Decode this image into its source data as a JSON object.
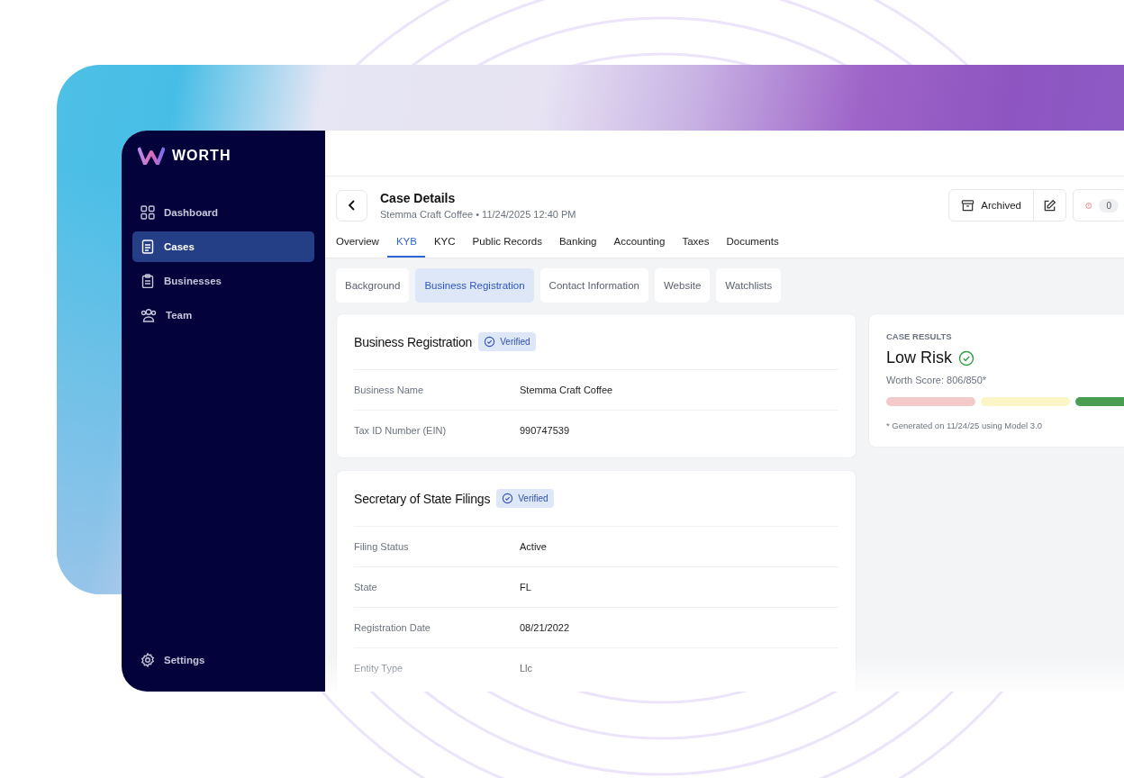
{
  "brand": {
    "name": "WORTH"
  },
  "sidebar": {
    "items": [
      {
        "label": "Dashboard",
        "selected": false
      },
      {
        "label": "Cases",
        "selected": true
      },
      {
        "label": "Businesses",
        "selected": false
      },
      {
        "label": "Team",
        "selected": false
      }
    ],
    "footer_item": {
      "label": "Settings",
      "selected": false
    }
  },
  "header": {
    "title": "Case Details",
    "subtitle": "Stemma Craft Coffee • 11/24/2025 12:40 PM",
    "status_button": "Archived",
    "alert_count": "0"
  },
  "tabs": [
    {
      "label": "Overview",
      "selected": false
    },
    {
      "label": "KYB",
      "selected": true
    },
    {
      "label": "KYC",
      "selected": false
    },
    {
      "label": "Public Records",
      "selected": false
    },
    {
      "label": "Banking",
      "selected": false
    },
    {
      "label": "Accounting",
      "selected": false
    },
    {
      "label": "Taxes",
      "selected": false
    },
    {
      "label": "Documents",
      "selected": false
    }
  ],
  "subtabs": [
    {
      "label": "Background",
      "selected": false
    },
    {
      "label": "Business Registration",
      "selected": true
    },
    {
      "label": "Contact Information",
      "selected": false
    },
    {
      "label": "Website",
      "selected": false
    },
    {
      "label": "Watchlists",
      "selected": false
    }
  ],
  "cards": [
    {
      "title": "Business Registration",
      "badge": "Verified",
      "rows": [
        {
          "label": "Business Name",
          "value": "Stemma Craft Coffee"
        },
        {
          "label": "Tax ID Number (EIN)",
          "value": "990747539"
        }
      ]
    },
    {
      "title": "Secretary of State Filings",
      "badge": "Verified",
      "rows": [
        {
          "label": "Filing Status",
          "value": "Active"
        },
        {
          "label": "State",
          "value": "FL"
        },
        {
          "label": "Registration Date",
          "value": "08/21/2022"
        },
        {
          "label": "Entity Type",
          "value": "Llc"
        }
      ]
    }
  ],
  "case_results": {
    "heading": "CASE RESULTS",
    "risk": "Low Risk",
    "score": "Worth Score: 806/850*",
    "note": "* Generated on 11/24/25 using Model 3.0"
  }
}
